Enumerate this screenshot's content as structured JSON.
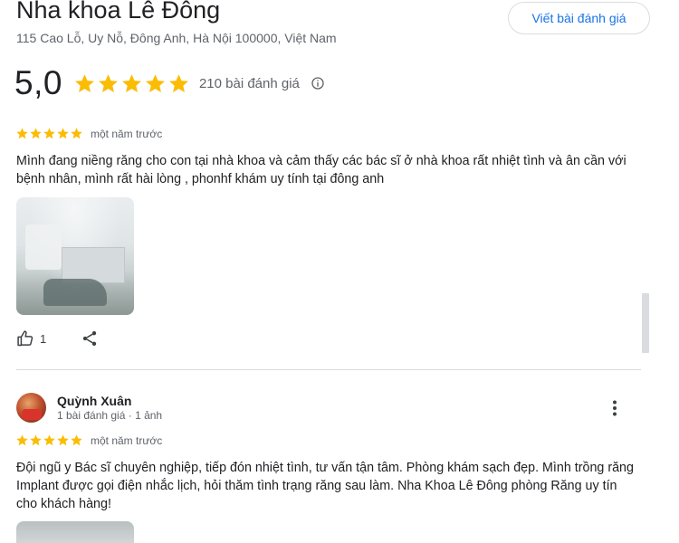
{
  "place": {
    "title": "Nha khoa Lê Đông",
    "address": "115 Cao Lỗ, Uy Nỗ, Đông Anh, Hà Nội 100000, Việt Nam",
    "write_review_label": "Viết bài đánh giá"
  },
  "summary": {
    "rating": "5,0",
    "stars": 5,
    "review_count": "210 bài đánh giá",
    "star_color": "#fbbc04"
  },
  "reviews": [
    {
      "stars": 5,
      "date": "một năm trước",
      "text": "Mình đang niềng răng cho con tại nhà khoa và cảm thấy các bác sĩ ở nhà khoa rất nhiệt tình và ân cần với bệnh nhân, mình rất hài lòng , phonhf khám uy tính tại đông anh",
      "likes": "1"
    },
    {
      "author": "Quỳnh Xuân",
      "author_meta": "1 bài đánh giá · 1 ảnh",
      "stars": 5,
      "date": "một năm trước",
      "text": "Đội ngũ y Bác sĩ chuyên nghiệp, tiếp đón nhiệt tình, tư vấn tận tâm. Phòng khám sạch đẹp. Mình trồng răng Implant được gọi điện nhắc lịch, hỏi thăm tình trạng răng sau làm. Nha Khoa Lê Đông phòng Răng uy tín cho khách hàng!"
    }
  ],
  "colors": {
    "accent": "#1a73e8",
    "secondary_text": "#5f6368"
  }
}
